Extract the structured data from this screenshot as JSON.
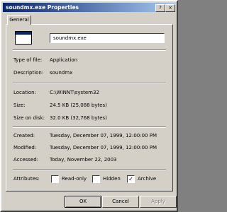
{
  "window": {
    "title": "soundmx.exe Properties",
    "help_glyph": "?",
    "close_glyph": "×"
  },
  "tabs": [
    {
      "label": "General"
    }
  ],
  "file": {
    "name": "soundmx.exe"
  },
  "fields": {
    "type_label": "Type of file:",
    "type_value": "Application",
    "description_label": "Description:",
    "description_value": "soundmx",
    "location_label": "Location:",
    "location_value": "C:\\WINNT\\system32",
    "size_label": "Size:",
    "size_value": "24.5 KB (25,088 bytes)",
    "size_on_disk_label": "Size on disk:",
    "size_on_disk_value": "32.0 KB (32,768 bytes)",
    "created_label": "Created:",
    "created_value": "Tuesday, December 07, 1999, 12:00:00 PM",
    "modified_label": "Modified:",
    "modified_value": "Tuesday, December 07, 1999, 12:00:00 PM",
    "accessed_label": "Accessed:",
    "accessed_value": "Today, November 22, 2003"
  },
  "attributes": {
    "label": "Attributes:",
    "read_only": {
      "label": "Read-only",
      "checked": false,
      "mark": ""
    },
    "hidden": {
      "label": "Hidden",
      "checked": false,
      "mark": ""
    },
    "archive": {
      "label": "Archive",
      "checked": true,
      "mark": "✓"
    }
  },
  "buttons": {
    "ok": "OK",
    "cancel": "Cancel",
    "apply": "Apply"
  },
  "colors": {
    "face": "#d4d0c8",
    "titlebar_start": "#0a246a",
    "titlebar_end": "#a6caf0"
  }
}
